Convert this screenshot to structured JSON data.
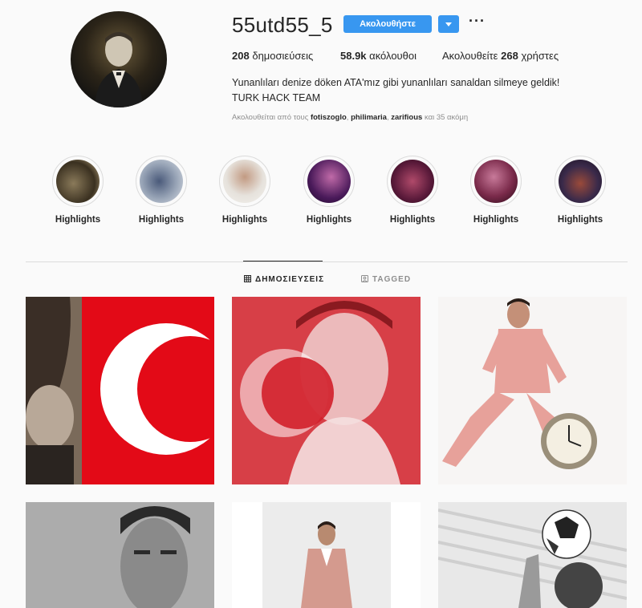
{
  "profile": {
    "username": "55utd55_5",
    "follow_label": "Ακολουθήστε",
    "more_label": "···",
    "stats": {
      "posts_count": "208",
      "posts_label": "δημοσιεύσεις",
      "followers_count": "58.9k",
      "followers_label": "ακόλουθοι",
      "following_prefix": "Ακολουθείτε",
      "following_count": "268",
      "following_suffix": "χρήστες"
    },
    "bio_line1": "Yunanlıları denize döken ATA'mız gibi yunanlıları sanaldan silmeye geldik!",
    "bio_line2": "TURK HACK TEAM",
    "followed_by": {
      "prefix": "Ακολουθείται από τους",
      "user1": "fotiszoglo",
      "sep1": ",",
      "user2": "philimaria",
      "sep2": ",",
      "user3": "zarifious",
      "suffix": "και 35 ακόμη"
    }
  },
  "highlights": [
    {
      "label": "Highlights"
    },
    {
      "label": "Highlights"
    },
    {
      "label": "Highlights"
    },
    {
      "label": "Highlights"
    },
    {
      "label": "Highlights"
    },
    {
      "label": "Highlights"
    },
    {
      "label": "Highlights"
    }
  ],
  "tabs": {
    "posts": "ΔΗΜΟΣΙΕΥΣΕΙΣ",
    "tagged": "TAGGED"
  },
  "colors": {
    "accent_blue": "#3897f0",
    "flag_red": "#e30a17",
    "text_dark": "#262626",
    "text_muted": "#8e8e8e"
  }
}
